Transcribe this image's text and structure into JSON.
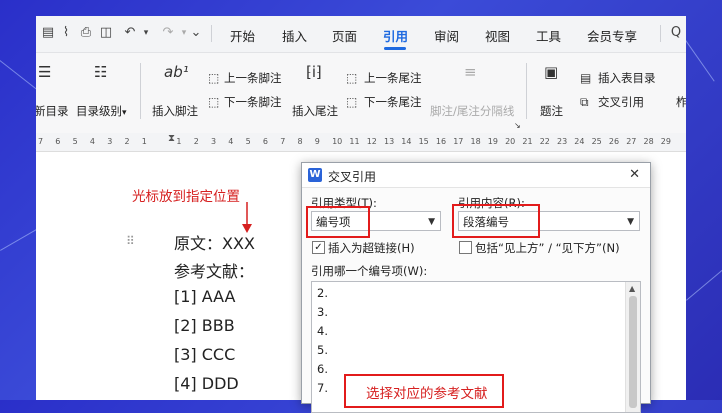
{
  "quick_access": {
    "icons": [
      "save-icon",
      "paperclip-icon",
      "print-icon",
      "preview-icon",
      "undo-icon",
      "redo-icon",
      "more-icon"
    ],
    "undo_caret": "▾",
    "redo_caret": "▾",
    "more": "⌄"
  },
  "tabs": [
    "开始",
    "插入",
    "页面",
    "引用",
    "审阅",
    "视图",
    "工具",
    "会员专享"
  ],
  "active_tab": "引用",
  "search_icon_label": "Q",
  "ribbon": {
    "toc": "新目录",
    "toc_level": "目录级别",
    "toc_level_caret": "▾",
    "insert_footnote": "插入脚注",
    "prev_footnote": "上一条脚注",
    "next_footnote": "下一条脚注",
    "insert_endnote": "插入尾注",
    "prev_endnote": "上一条尾注",
    "next_endnote": "下一条尾注",
    "footnote_separator": "脚注/尾注分隔线",
    "caption": "题注",
    "insert_table_of_figures": "插入表目录",
    "cross_reference": "交叉引用",
    "more_cut": "柞"
  },
  "ruler": {
    "labels": [
      "7",
      "6",
      "5",
      "4",
      "3",
      "2",
      "1",
      "",
      "1",
      "2",
      "3",
      "4",
      "5",
      "6",
      "7",
      "8",
      "9",
      "10",
      "11",
      "12",
      "13",
      "14",
      "15",
      "16",
      "17",
      "18",
      "19",
      "20",
      "21",
      "22",
      "23",
      "24",
      "25",
      "26",
      "27",
      "28",
      "29"
    ]
  },
  "document": {
    "annotation_cursor": "光标放到指定位置",
    "line1_label": "原文：",
    "line1_value": "XXX",
    "line2": "参考文献：",
    "refs": [
      "[1]  AAA",
      "[2]  BBB",
      "[3]  CCC",
      "[4]  DDD"
    ]
  },
  "dialog": {
    "logo": "W",
    "title": "交叉引用",
    "close": "✕",
    "ref_type_label": "引用类型(T):",
    "ref_type_value": "编号项",
    "ref_content_label": "引用内容(R):",
    "ref_content_value": "段落编号",
    "insert_hyperlink_label": "插入为超链接(H)",
    "insert_hyperlink_checked": "✓",
    "include_above_below_label": "包括“见上方” / “见下方”(N)",
    "list_label": "引用哪一个编号项(W):",
    "list_items": [
      "2.",
      "3.",
      "4.",
      "5.",
      "6.",
      "7."
    ],
    "scroll_up": "▲"
  },
  "annotation_select": "选择对应的参考文献",
  "colors": {
    "accent": "#1f6ae0",
    "annotation_red": "#d62020",
    "background_blue": "#2a2fc9"
  }
}
